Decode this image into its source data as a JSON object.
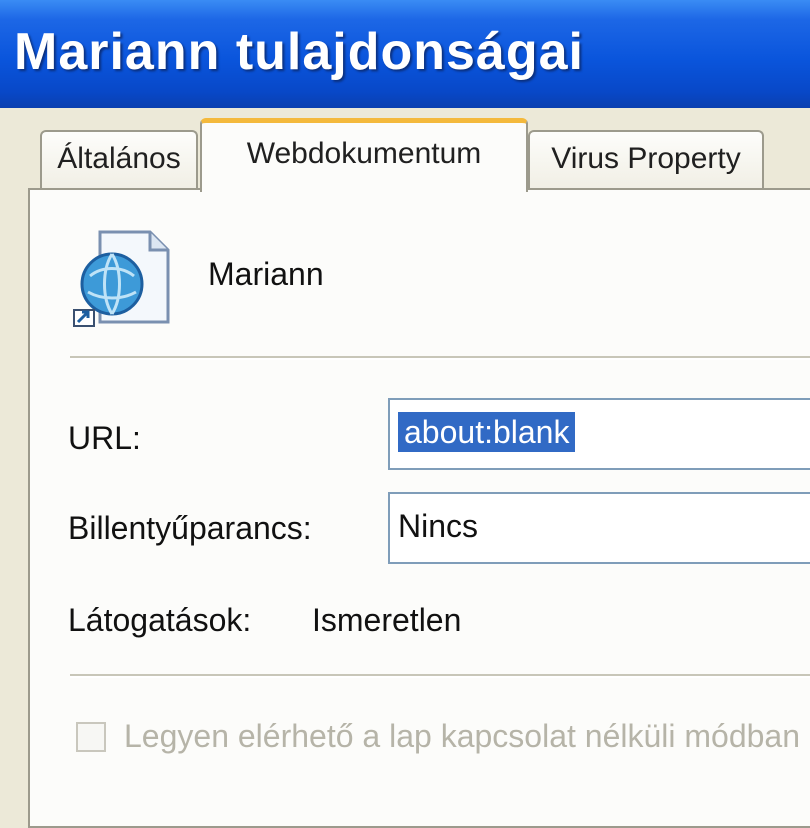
{
  "window": {
    "title": "Mariann tulajdonságai"
  },
  "tabs": [
    {
      "label": "Általános",
      "active": false
    },
    {
      "label": "Webdokumentum",
      "active": true
    },
    {
      "label": "Virus Property",
      "active": false
    }
  ],
  "item": {
    "icon": "internet-shortcut-icon",
    "name": "Mariann"
  },
  "fields": {
    "url_label": "URL:",
    "url_value": "about:blank",
    "shortcut_label": "Billentyűparancs:",
    "shortcut_value": "Nincs",
    "visits_label": "Látogatások:",
    "visits_value": "Ismeretlen"
  },
  "offline": {
    "checkbox_label": "Legyen elérhető a lap kapcsolat nélküli módban"
  },
  "colors": {
    "titlebar": "#0a55dc",
    "selection": "#316ac5",
    "active_tab_accent": "#f4b93c"
  }
}
